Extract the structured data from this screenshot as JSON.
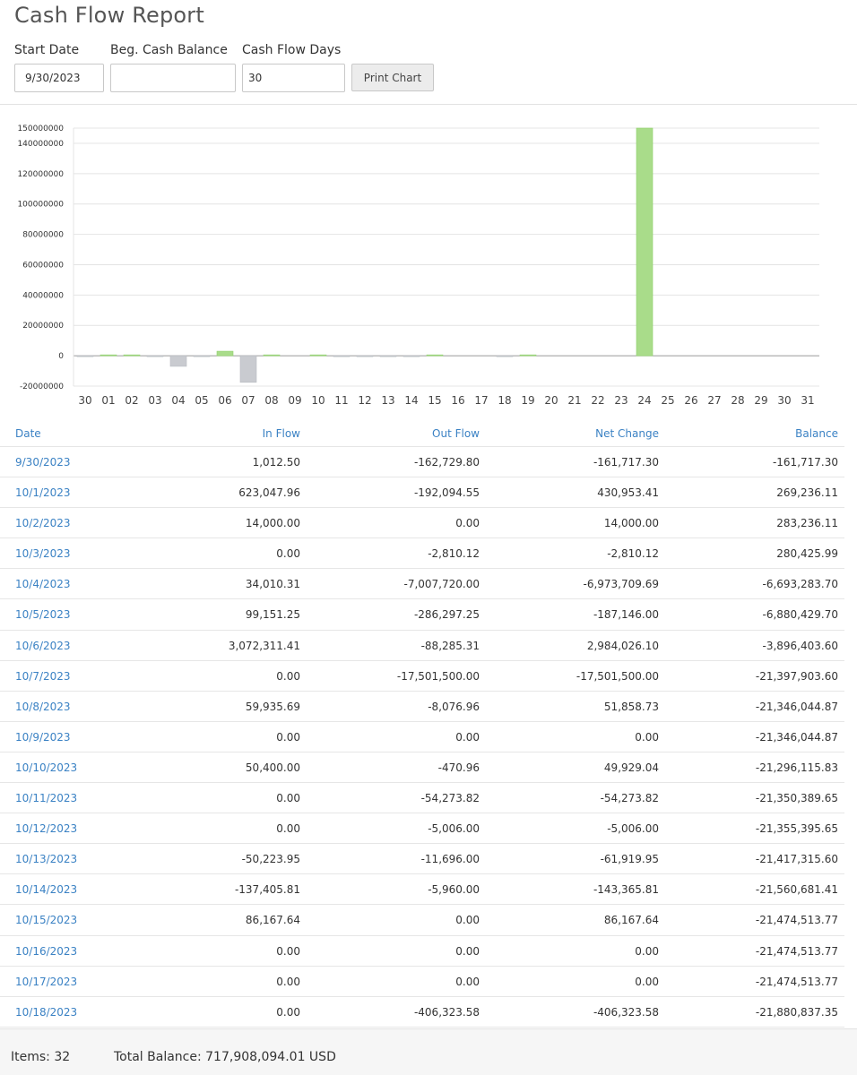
{
  "page": {
    "title": "Cash Flow Report"
  },
  "form": {
    "start_date_label": "Start Date",
    "start_date_value": "9/30/2023",
    "beg_balance_label": "Beg. Cash Balance",
    "beg_balance_value": "",
    "days_label": "Cash Flow Days",
    "days_value": "30",
    "print_label": "Print Chart"
  },
  "colors": {
    "positive": "#a9dc8a",
    "negative": "#c9cbd0",
    "link": "#3b82c4",
    "grid": "#e4e4e4"
  },
  "chart_data": {
    "type": "bar",
    "categories": [
      "30",
      "01",
      "02",
      "03",
      "04",
      "05",
      "06",
      "07",
      "08",
      "09",
      "10",
      "11",
      "12",
      "13",
      "14",
      "15",
      "16",
      "17",
      "18",
      "19",
      "20",
      "21",
      "22",
      "23",
      "24",
      "25",
      "26",
      "27",
      "28",
      "29",
      "30",
      "31"
    ],
    "values": [
      -161717.3,
      430953.41,
      14000,
      -2810.12,
      -6973709.69,
      -187146,
      2984026.1,
      -17501500,
      51858.73,
      0,
      49929.04,
      -54273.82,
      -5006,
      -61919.95,
      -143365.81,
      86167.64,
      0,
      0,
      -406323.58,
      300000,
      0,
      0,
      0,
      0,
      150000000,
      0,
      0,
      0,
      0,
      0,
      0,
      0
    ],
    "yticks": [
      -20000000,
      0,
      20000000,
      40000000,
      60000000,
      80000000,
      100000000,
      120000000,
      140000000,
      150000000
    ],
    "ytick_labels": [
      "-20000000",
      "0",
      "20000000",
      "40000000",
      "60000000",
      "80000000",
      "100000000",
      "120000000",
      "140000000",
      "150000000"
    ],
    "ylim": [
      -20000000,
      150000000
    ],
    "grid": true
  },
  "table": {
    "headers": {
      "date": "Date",
      "in_flow": "In Flow",
      "out_flow": "Out Flow",
      "net_change": "Net Change",
      "balance": "Balance"
    },
    "rows": [
      {
        "date": "9/30/2023",
        "in": "1,012.50",
        "out": "-162,729.80",
        "net": "-161,717.30",
        "bal": "-161,717.30"
      },
      {
        "date": "10/1/2023",
        "in": "623,047.96",
        "out": "-192,094.55",
        "net": "430,953.41",
        "bal": "269,236.11"
      },
      {
        "date": "10/2/2023",
        "in": "14,000.00",
        "out": "0.00",
        "net": "14,000.00",
        "bal": "283,236.11"
      },
      {
        "date": "10/3/2023",
        "in": "0.00",
        "out": "-2,810.12",
        "net": "-2,810.12",
        "bal": "280,425.99"
      },
      {
        "date": "10/4/2023",
        "in": "34,010.31",
        "out": "-7,007,720.00",
        "net": "-6,973,709.69",
        "bal": "-6,693,283.70"
      },
      {
        "date": "10/5/2023",
        "in": "99,151.25",
        "out": "-286,297.25",
        "net": "-187,146.00",
        "bal": "-6,880,429.70"
      },
      {
        "date": "10/6/2023",
        "in": "3,072,311.41",
        "out": "-88,285.31",
        "net": "2,984,026.10",
        "bal": "-3,896,403.60"
      },
      {
        "date": "10/7/2023",
        "in": "0.00",
        "out": "-17,501,500.00",
        "net": "-17,501,500.00",
        "bal": "-21,397,903.60"
      },
      {
        "date": "10/8/2023",
        "in": "59,935.69",
        "out": "-8,076.96",
        "net": "51,858.73",
        "bal": "-21,346,044.87"
      },
      {
        "date": "10/9/2023",
        "in": "0.00",
        "out": "0.00",
        "net": "0.00",
        "bal": "-21,346,044.87"
      },
      {
        "date": "10/10/2023",
        "in": "50,400.00",
        "out": "-470.96",
        "net": "49,929.04",
        "bal": "-21,296,115.83"
      },
      {
        "date": "10/11/2023",
        "in": "0.00",
        "out": "-54,273.82",
        "net": "-54,273.82",
        "bal": "-21,350,389.65"
      },
      {
        "date": "10/12/2023",
        "in": "0.00",
        "out": "-5,006.00",
        "net": "-5,006.00",
        "bal": "-21,355,395.65"
      },
      {
        "date": "10/13/2023",
        "in": "-50,223.95",
        "out": "-11,696.00",
        "net": "-61,919.95",
        "bal": "-21,417,315.60"
      },
      {
        "date": "10/14/2023",
        "in": "-137,405.81",
        "out": "-5,960.00",
        "net": "-143,365.81",
        "bal": "-21,560,681.41"
      },
      {
        "date": "10/15/2023",
        "in": "86,167.64",
        "out": "0.00",
        "net": "86,167.64",
        "bal": "-21,474,513.77"
      },
      {
        "date": "10/16/2023",
        "in": "0.00",
        "out": "0.00",
        "net": "0.00",
        "bal": "-21,474,513.77"
      },
      {
        "date": "10/17/2023",
        "in": "0.00",
        "out": "0.00",
        "net": "0.00",
        "bal": "-21,474,513.77"
      },
      {
        "date": "10/18/2023",
        "in": "0.00",
        "out": "-406,323.58",
        "net": "-406,323.58",
        "bal": "-21,880,837.35"
      }
    ]
  },
  "footer": {
    "items": "Items: 32",
    "total": "Total Balance: 717,908,094.01 USD"
  }
}
